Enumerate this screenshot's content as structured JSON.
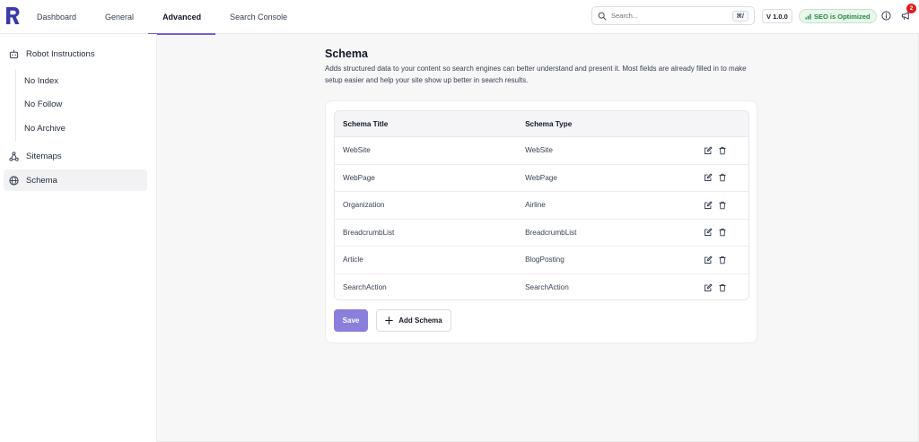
{
  "topbar": {
    "tabs": [
      {
        "label": "Dashboard"
      },
      {
        "label": "General"
      },
      {
        "label": "Advanced",
        "active": true
      },
      {
        "label": "Search Console"
      }
    ],
    "search": {
      "placeholder": "Search...",
      "shortcut": "⌘/"
    },
    "version": "V 1.0.0",
    "seo_status": "SEO is Optimized",
    "notification_count": "2",
    "icons": [
      "logo",
      "search-icon",
      "seo-status-icon",
      "info-icon",
      "megaphone-icon"
    ]
  },
  "sidebar": {
    "items": [
      {
        "label": "Robot Instructions",
        "icon": "robot-icon"
      },
      {
        "label": "Sitemaps",
        "icon": "sitemap-icon"
      },
      {
        "label": "Schema",
        "icon": "globe-icon",
        "active": true
      }
    ],
    "sub_items": [
      {
        "label": "No Index"
      },
      {
        "label": "No Follow"
      },
      {
        "label": "No Archive"
      }
    ]
  },
  "main": {
    "title": "Schema",
    "description": "Adds structured data to your content so search engines can better understand and present it. Most fields are already filled in to make setup easier and help your site show up better in search results.",
    "table": {
      "headers": [
        "Schema Title",
        "Schema Type",
        ""
      ],
      "rows": [
        {
          "title": "WebSite",
          "type": "WebSite"
        },
        {
          "title": "WebPage",
          "type": "WebPage"
        },
        {
          "title": "Organization",
          "type": "Airline"
        },
        {
          "title": "BreadcrumbList",
          "type": "BreadcrumbList"
        },
        {
          "title": "Article",
          "type": "BlogPosting"
        },
        {
          "title": "SearchAction",
          "type": "SearchAction"
        }
      ],
      "row_actions": [
        "edit-icon",
        "trash-icon"
      ]
    },
    "buttons": {
      "save": "Save",
      "add": "Add Schema"
    }
  },
  "colors": {
    "accent": "#6d5fd3",
    "save_button": "#8a7fdc",
    "seo_green": "#1f8a3a",
    "badge_red": "#e11d1d"
  }
}
